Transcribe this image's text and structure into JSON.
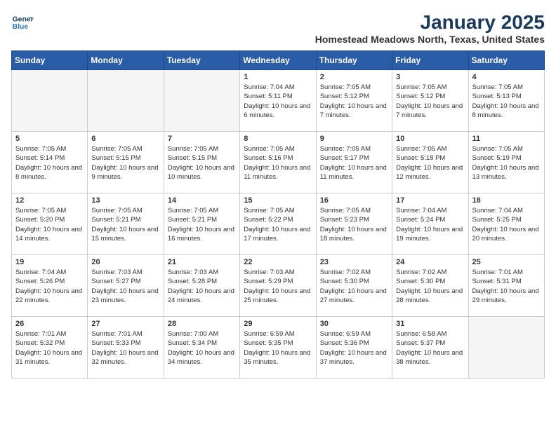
{
  "header": {
    "logo_line1": "General",
    "logo_line2": "Blue",
    "title": "January 2025",
    "subtitle": "Homestead Meadows North, Texas, United States"
  },
  "weekdays": [
    "Sunday",
    "Monday",
    "Tuesday",
    "Wednesday",
    "Thursday",
    "Friday",
    "Saturday"
  ],
  "weeks": [
    [
      {
        "day": "",
        "info": ""
      },
      {
        "day": "",
        "info": ""
      },
      {
        "day": "",
        "info": ""
      },
      {
        "day": "1",
        "info": "Sunrise: 7:04 AM\nSunset: 5:11 PM\nDaylight: 10 hours\nand 6 minutes."
      },
      {
        "day": "2",
        "info": "Sunrise: 7:05 AM\nSunset: 5:12 PM\nDaylight: 10 hours\nand 7 minutes."
      },
      {
        "day": "3",
        "info": "Sunrise: 7:05 AM\nSunset: 5:12 PM\nDaylight: 10 hours\nand 7 minutes."
      },
      {
        "day": "4",
        "info": "Sunrise: 7:05 AM\nSunset: 5:13 PM\nDaylight: 10 hours\nand 8 minutes."
      }
    ],
    [
      {
        "day": "5",
        "info": "Sunrise: 7:05 AM\nSunset: 5:14 PM\nDaylight: 10 hours\nand 8 minutes."
      },
      {
        "day": "6",
        "info": "Sunrise: 7:05 AM\nSunset: 5:15 PM\nDaylight: 10 hours\nand 9 minutes."
      },
      {
        "day": "7",
        "info": "Sunrise: 7:05 AM\nSunset: 5:15 PM\nDaylight: 10 hours\nand 10 minutes."
      },
      {
        "day": "8",
        "info": "Sunrise: 7:05 AM\nSunset: 5:16 PM\nDaylight: 10 hours\nand 11 minutes."
      },
      {
        "day": "9",
        "info": "Sunrise: 7:05 AM\nSunset: 5:17 PM\nDaylight: 10 hours\nand 11 minutes."
      },
      {
        "day": "10",
        "info": "Sunrise: 7:05 AM\nSunset: 5:18 PM\nDaylight: 10 hours\nand 12 minutes."
      },
      {
        "day": "11",
        "info": "Sunrise: 7:05 AM\nSunset: 5:19 PM\nDaylight: 10 hours\nand 13 minutes."
      }
    ],
    [
      {
        "day": "12",
        "info": "Sunrise: 7:05 AM\nSunset: 5:20 PM\nDaylight: 10 hours\nand 14 minutes."
      },
      {
        "day": "13",
        "info": "Sunrise: 7:05 AM\nSunset: 5:21 PM\nDaylight: 10 hours\nand 15 minutes."
      },
      {
        "day": "14",
        "info": "Sunrise: 7:05 AM\nSunset: 5:21 PM\nDaylight: 10 hours\nand 16 minutes."
      },
      {
        "day": "15",
        "info": "Sunrise: 7:05 AM\nSunset: 5:22 PM\nDaylight: 10 hours\nand 17 minutes."
      },
      {
        "day": "16",
        "info": "Sunrise: 7:05 AM\nSunset: 5:23 PM\nDaylight: 10 hours\nand 18 minutes."
      },
      {
        "day": "17",
        "info": "Sunrise: 7:04 AM\nSunset: 5:24 PM\nDaylight: 10 hours\nand 19 minutes."
      },
      {
        "day": "18",
        "info": "Sunrise: 7:04 AM\nSunset: 5:25 PM\nDaylight: 10 hours\nand 20 minutes."
      }
    ],
    [
      {
        "day": "19",
        "info": "Sunrise: 7:04 AM\nSunset: 5:26 PM\nDaylight: 10 hours\nand 22 minutes."
      },
      {
        "day": "20",
        "info": "Sunrise: 7:03 AM\nSunset: 5:27 PM\nDaylight: 10 hours\nand 23 minutes."
      },
      {
        "day": "21",
        "info": "Sunrise: 7:03 AM\nSunset: 5:28 PM\nDaylight: 10 hours\nand 24 minutes."
      },
      {
        "day": "22",
        "info": "Sunrise: 7:03 AM\nSunset: 5:29 PM\nDaylight: 10 hours\nand 25 minutes."
      },
      {
        "day": "23",
        "info": "Sunrise: 7:02 AM\nSunset: 5:30 PM\nDaylight: 10 hours\nand 27 minutes."
      },
      {
        "day": "24",
        "info": "Sunrise: 7:02 AM\nSunset: 5:30 PM\nDaylight: 10 hours\nand 28 minutes."
      },
      {
        "day": "25",
        "info": "Sunrise: 7:01 AM\nSunset: 5:31 PM\nDaylight: 10 hours\nand 29 minutes."
      }
    ],
    [
      {
        "day": "26",
        "info": "Sunrise: 7:01 AM\nSunset: 5:32 PM\nDaylight: 10 hours\nand 31 minutes."
      },
      {
        "day": "27",
        "info": "Sunrise: 7:01 AM\nSunset: 5:33 PM\nDaylight: 10 hours\nand 32 minutes."
      },
      {
        "day": "28",
        "info": "Sunrise: 7:00 AM\nSunset: 5:34 PM\nDaylight: 10 hours\nand 34 minutes."
      },
      {
        "day": "29",
        "info": "Sunrise: 6:59 AM\nSunset: 5:35 PM\nDaylight: 10 hours\nand 35 minutes."
      },
      {
        "day": "30",
        "info": "Sunrise: 6:59 AM\nSunset: 5:36 PM\nDaylight: 10 hours\nand 37 minutes."
      },
      {
        "day": "31",
        "info": "Sunrise: 6:58 AM\nSunset: 5:37 PM\nDaylight: 10 hours\nand 38 minutes."
      },
      {
        "day": "",
        "info": ""
      }
    ]
  ]
}
